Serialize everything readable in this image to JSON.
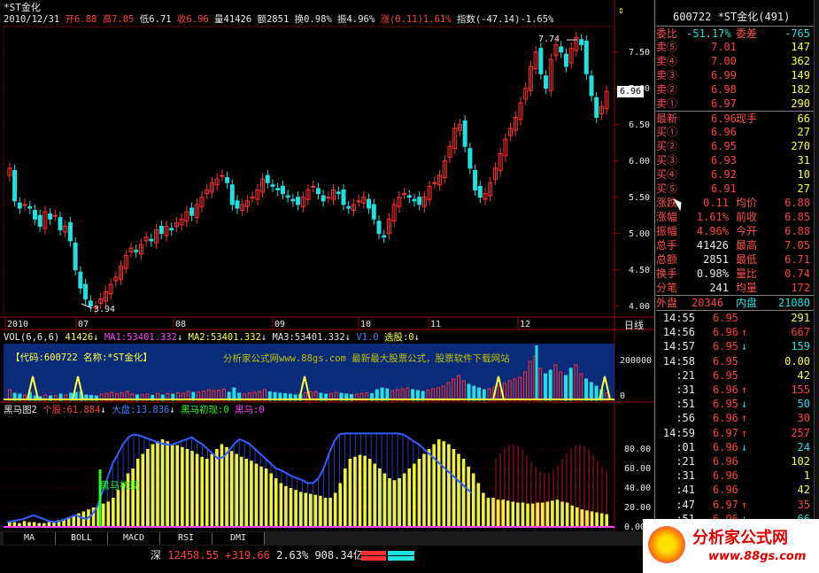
{
  "stock": {
    "code": "600722",
    "name": "*ST金化",
    "rank": "(491)"
  },
  "main_chart": {
    "title": "*ST金化",
    "date": "2010/12/31",
    "open_label": "开",
    "open": "6.88",
    "high_label": "高",
    "high": "7.05",
    "low_label": "低",
    "low": "6.71",
    "close_label": "收",
    "close": "6.96",
    "volume_label": "量",
    "volume": "41426",
    "amount_label": "额",
    "amount": "2851",
    "turnover_label": "换",
    "turnover": "0.98%",
    "amplitude_label": "振",
    "amplitude": "4.96%",
    "change_label": "涨",
    "change": "(0.11)",
    "change_pct": "1.61%",
    "index_label": "指数",
    "index_change": "(-47.14)",
    "index_pct": "-1.65%",
    "max_label": "7.74",
    "min_label": "3.94",
    "price_axis": [
      "7.50",
      "7.00",
      "6.50",
      "6.00",
      "5.50",
      "5.00",
      "4.50",
      "4.00"
    ],
    "current_price_tag": "6.96",
    "months": [
      "2010",
      "07",
      "08",
      "09",
      "10",
      "11",
      "12"
    ],
    "period": "日线"
  },
  "chart_data": [
    {
      "type": "candlestick",
      "title": "*ST金化",
      "ylim": [
        3.85,
        7.85
      ],
      "x_ticks": [
        "2010",
        "07",
        "08",
        "09",
        "10",
        "11",
        "12"
      ],
      "series": [
        {
          "values": [
            5.9,
            5.45,
            5.35,
            5.4,
            5.35,
            5.2,
            5.1,
            5.3,
            5.2,
            5.25,
            5.05,
            5.1,
            4.9,
            4.5,
            4.25,
            4.1,
            4.0,
            3.99,
            4.1,
            4.2,
            4.3,
            4.4,
            4.55,
            4.7,
            4.8,
            4.75,
            4.85,
            4.95,
            4.9,
            5.05,
            5.0,
            5.1,
            5.05,
            5.15,
            5.2,
            5.3,
            5.25,
            5.4,
            5.5,
            5.6,
            5.7,
            5.75,
            5.8,
            5.7,
            5.4,
            5.35,
            5.4,
            5.45,
            5.5,
            5.6,
            5.75,
            5.7,
            5.65,
            5.6,
            5.55,
            5.5,
            5.45,
            5.4,
            5.5,
            5.6,
            5.65,
            5.55,
            5.45,
            5.5,
            5.6,
            5.55,
            5.4,
            5.35,
            5.4,
            5.45,
            5.5,
            5.35,
            5.2,
            5.0,
            4.95,
            5.2,
            5.4,
            5.5,
            5.55,
            5.5,
            5.45,
            5.4,
            5.5,
            5.65,
            5.7,
            5.8,
            6.0,
            6.2,
            6.45,
            6.5,
            6.2,
            5.9,
            5.6,
            5.5,
            5.55,
            5.7,
            5.9,
            6.1,
            6.3,
            6.45,
            6.6,
            6.8,
            7.0,
            7.3,
            7.5,
            7.2,
            7.0,
            7.4,
            7.6,
            7.5,
            7.3,
            7.55,
            7.7,
            7.6,
            7.2,
            6.9,
            6.6,
            6.75,
            6.96
          ]
        }
      ]
    },
    {
      "type": "bar",
      "title": "VOL(6,6,6)",
      "ylim": [
        0,
        320000
      ],
      "y_ticks": [
        "200000",
        "0"
      ],
      "series": [
        {
          "name": "VOL",
          "values": [
            60000,
            40000,
            35000,
            30000,
            45000,
            25000,
            20000,
            30000,
            25000,
            28000,
            35000,
            30000,
            40000,
            45000,
            50000,
            30000,
            28000,
            25000,
            35000,
            40000,
            45000,
            38000,
            42000,
            50000,
            36000,
            30000,
            33000,
            35000,
            28000,
            40000,
            30000,
            38000,
            35000,
            42000,
            40000,
            50000,
            45000,
            48000,
            52000,
            60000,
            55000,
            58000,
            62000,
            45000,
            70000,
            40000,
            35000,
            42000,
            45000,
            50000,
            60000,
            48000,
            44000,
            40000,
            38000,
            35000,
            30000,
            34000,
            42000,
            48000,
            50000,
            40000,
            35000,
            38000,
            44000,
            40000,
            36000,
            32000,
            35000,
            40000,
            42000,
            38000,
            60000,
            70000,
            65000,
            55000,
            60000,
            65000,
            70000,
            60000,
            55000,
            50000,
            58000,
            65000,
            70000,
            80000,
            100000,
            120000,
            140000,
            110000,
            90000,
            80000,
            70000,
            60000,
            65000,
            75000,
            85000,
            95000,
            110000,
            120000,
            130000,
            160000,
            220000,
            250000,
            180000,
            150000,
            170000,
            200000,
            160000,
            140000,
            180000,
            200000,
            150000,
            120000,
            100000,
            80000,
            60000,
            41426
          ]
        }
      ]
    },
    {
      "type": "bar",
      "title": "黑马图2",
      "ylim": [
        0,
        100
      ],
      "y_ticks": [
        "80.00",
        "60.00",
        "40.00",
        "20.00",
        "0.00"
      ],
      "series": [
        {
          "name": "个股",
          "values": [
            5,
            5,
            4,
            6,
            5,
            5,
            4,
            4,
            5,
            6,
            7,
            8,
            10,
            12,
            14,
            16,
            18,
            20,
            22,
            24,
            26,
            30,
            38,
            45,
            55,
            60,
            70,
            75,
            80,
            85,
            88,
            90,
            88,
            85,
            84,
            82,
            80,
            78,
            75,
            72,
            70,
            75,
            80,
            85,
            82,
            78,
            75,
            72,
            70,
            68,
            65,
            62,
            60,
            55,
            50,
            45,
            42,
            40,
            38,
            36,
            35,
            34,
            33,
            32,
            30,
            30,
            35,
            45,
            60,
            70,
            72,
            74,
            73,
            70,
            65,
            60,
            55,
            50,
            48,
            50,
            55,
            60,
            65,
            70,
            75,
            80,
            85,
            90,
            88,
            85,
            80,
            75,
            70,
            62,
            55,
            45,
            35,
            30,
            30,
            28,
            28,
            27,
            26,
            25,
            25,
            24,
            24,
            25,
            25,
            26,
            27,
            28,
            26,
            25,
            22,
            20,
            18,
            17,
            16,
            15,
            14,
            13
          ]
        },
        {
          "name": "大盘",
          "values": [
            5,
            6,
            7,
            8,
            10,
            12,
            10,
            8,
            6,
            5,
            6,
            8,
            10,
            12,
            10,
            8,
            12,
            20,
            35,
            50,
            65,
            75,
            85,
            92,
            95,
            94,
            92,
            90,
            88,
            86,
            85,
            84,
            86,
            88,
            90,
            92,
            88,
            85,
            80,
            75,
            70,
            72,
            78,
            85,
            90,
            88,
            85,
            80,
            75,
            70,
            65,
            60,
            58,
            55,
            52,
            50,
            48,
            45,
            45,
            50,
            60,
            75,
            88,
            95,
            96,
            96,
            96,
            96,
            96,
            96,
            96,
            96,
            96,
            96,
            96,
            95,
            92,
            88,
            85,
            80,
            75,
            70,
            65,
            60,
            55,
            50,
            45,
            40,
            35
          ]
        },
        {
          "name": "黑马初现",
          "values": []
        },
        {
          "name": "黑马",
          "values": []
        }
      ]
    }
  ],
  "vol_panel": {
    "title": "VOL(6,6,6)",
    "vol": "41426",
    "ma1": "MA1:53401.332",
    "ma2": "MA2:53401.332",
    "ma3": "MA3:53401.332",
    "v": "V1.0",
    "xuangu": "选股:0",
    "y_max": "200000",
    "y_zero": "0",
    "watermark": "【代码:600722 名称:*ST金化】",
    "watermark2": "分析家公式网www.88gs.com 最新最大股票公式，股票软件下载网站"
  },
  "horse_panel": {
    "title": "黑马图2",
    "stock_label": "个股:",
    "stock_value": "61.884",
    "market_label": "大盘:",
    "market_value": "13.836",
    "first_label": "黑马初现:",
    "first_value": "0",
    "horse_label": "黑马:",
    "horse_value": "0",
    "marker_text": "黑马初现",
    "y_ticks": [
      "80.00",
      "60.00",
      "40.00",
      "20.00",
      "0.00"
    ]
  },
  "tabs": [
    "MA",
    "BOLL",
    "MACD",
    "RSI",
    "DMI"
  ],
  "status_bar": {
    "market": "深",
    "index": "12458.55",
    "change": "+319.66",
    "pct": "2.63%",
    "amount": "908.34亿"
  },
  "quote": {
    "header": "600722 *ST金化(491)",
    "weibi_label": "委比",
    "weibi": "-51.17%",
    "weicha_label": "委差",
    "weicha": "-765",
    "asks": [
      {
        "label": "卖⑤",
        "price": "7.01",
        "vol": "147"
      },
      {
        "label": "卖④",
        "price": "7.00",
        "vol": "362"
      },
      {
        "label": "卖③",
        "price": "6.99",
        "vol": "149"
      },
      {
        "label": "卖②",
        "price": "6.98",
        "vol": "182"
      },
      {
        "label": "卖①",
        "price": "6.97",
        "vol": "290"
      }
    ],
    "last_label": "最新",
    "last": "6.96",
    "now_vol_label": "现手",
    "now_vol": "66",
    "bids": [
      {
        "label": "买①",
        "price": "6.96",
        "vol": "27"
      },
      {
        "label": "买②",
        "price": "6.95",
        "vol": "270"
      },
      {
        "label": "买③",
        "price": "6.93",
        "vol": "31"
      },
      {
        "label": "买④",
        "price": "6.92",
        "vol": "10"
      },
      {
        "label": "买⑤",
        "price": "6.91",
        "vol": "27"
      }
    ],
    "stats": [
      {
        "l1": "涨跌",
        "v1": "0.11",
        "l2": "均价",
        "v2": "6.88"
      },
      {
        "l1": "涨幅",
        "v1": "1.61%",
        "l2": "前收",
        "v2": "6.85"
      },
      {
        "l1": "振幅",
        "v1": "4.96%",
        "l2": "今开",
        "v2": "6.88"
      },
      {
        "l1": "总手",
        "v1": "41426",
        "l2": "最高",
        "v2": "7.05"
      },
      {
        "l1": "总额",
        "v1": "2851",
        "l2": "最低",
        "v2": "6.71"
      },
      {
        "l1": "换手",
        "v1": "0.98%",
        "l2": "量比",
        "v2": "0.74"
      },
      {
        "l1": "分笔",
        "v1": "241",
        "l2": "均量",
        "v2": "172"
      }
    ],
    "outer_label": "外盘",
    "outer": "20346",
    "inner_label": "内盘",
    "inner": "21080"
  },
  "ticks": [
    {
      "time": "14:55",
      "price": "6.95",
      "arrow": "",
      "vol": "291"
    },
    {
      "time": "14:56",
      "price": "6.96",
      "arrow": "↑",
      "vol": "667"
    },
    {
      "time": "14:57",
      "price": "6.95",
      "arrow": "↓",
      "vol": "159"
    },
    {
      "time": "14:58",
      "price": "6.95",
      "arrow": "",
      "vol": "0.00"
    },
    {
      "time": ":21",
      "price": "6.95",
      "arrow": "",
      "vol": "42"
    },
    {
      "time": ":31",
      "price": "6.96",
      "arrow": "↑",
      "vol": "155"
    },
    {
      "time": ":51",
      "price": "6.95",
      "arrow": "↓",
      "vol": "50"
    },
    {
      "time": ":56",
      "price": "6.96",
      "arrow": "↑",
      "vol": "30"
    },
    {
      "time": "14:59",
      "price": "6.97",
      "arrow": "↑",
      "vol": "257"
    },
    {
      "time": ":01",
      "price": "6.96",
      "arrow": "↓",
      "vol": "24"
    },
    {
      "time": ":21",
      "price": "6.96",
      "arrow": "",
      "vol": "102"
    },
    {
      "time": ":31",
      "price": "6.96",
      "arrow": "",
      "vol": "1"
    },
    {
      "time": ":41",
      "price": "6.96",
      "arrow": "",
      "vol": "42"
    },
    {
      "time": ":47",
      "price": "6.97",
      "arrow": "↑",
      "vol": "35"
    },
    {
      "time": ":51",
      "price": "6.96",
      "arrow": "↓",
      "vol": "66"
    }
  ],
  "logo": {
    "text": "分析家公式网",
    "url": "www.88gs.com"
  },
  "colors": {
    "up": "#ff3030",
    "down": "#20e0e0",
    "yellow": "#ffff40",
    "blue": "#3060ff",
    "green": "#20ff20",
    "magenta": "#ff40ff"
  }
}
